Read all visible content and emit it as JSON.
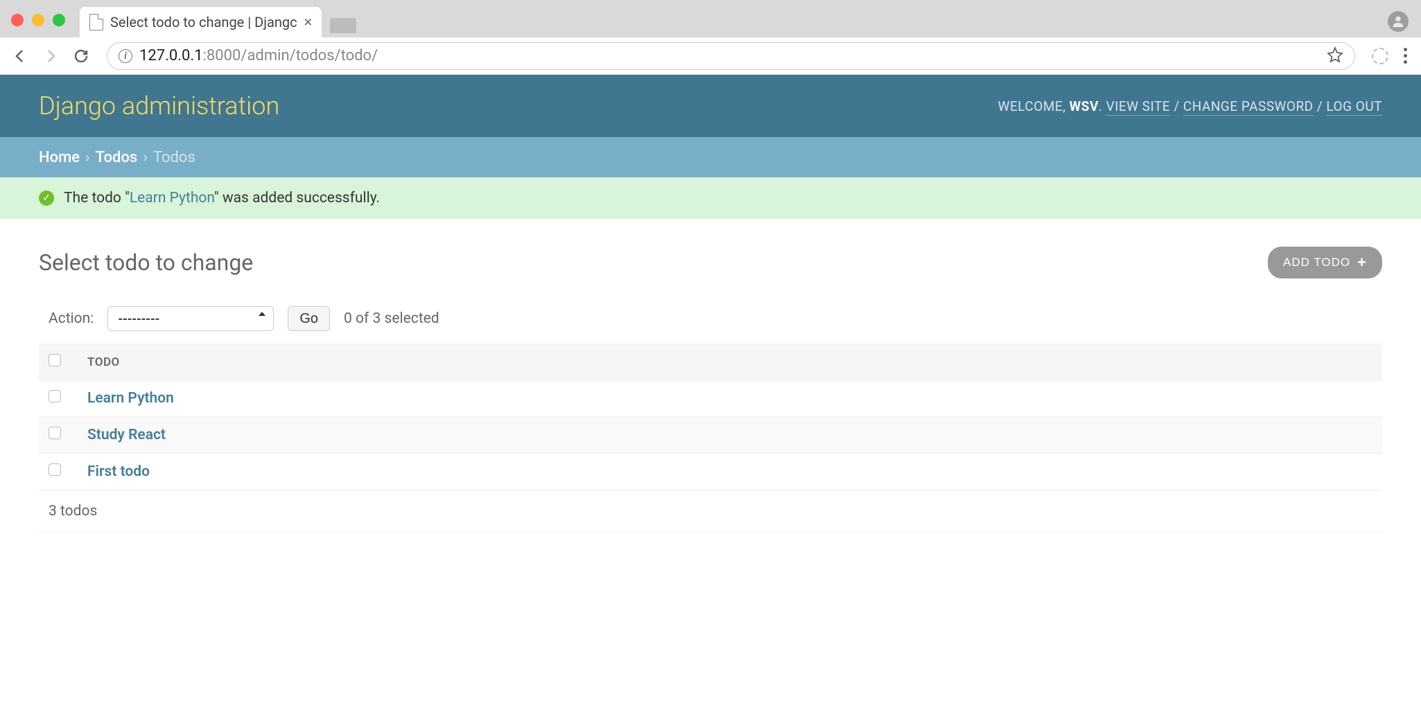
{
  "browser": {
    "tab_title": "Select todo to change | Djangc",
    "url_host": "127.0.0.1",
    "url_port_path": ":8000/admin/todos/todo/"
  },
  "header": {
    "site_title": "Django administration",
    "welcome_prefix": "WELCOME, ",
    "username": "WSV",
    "view_site": "VIEW SITE",
    "change_password": "CHANGE PASSWORD",
    "logout": "LOG OUT"
  },
  "breadcrumb": {
    "home": "Home",
    "app": "Todos",
    "current": "Todos"
  },
  "message": {
    "prefix": "The todo \"",
    "object": "Learn Python",
    "suffix": "\" was added successfully."
  },
  "content": {
    "page_title": "Select todo to change",
    "add_button": "ADD TODO",
    "action_label": "Action:",
    "action_placeholder": "---------",
    "go_label": "Go",
    "selection_count": "0 of 3 selected",
    "column_header": "TODO",
    "rows": [
      {
        "title": "Learn Python"
      },
      {
        "title": "Study React"
      },
      {
        "title": "First todo"
      }
    ],
    "paginator": "3 todos"
  }
}
